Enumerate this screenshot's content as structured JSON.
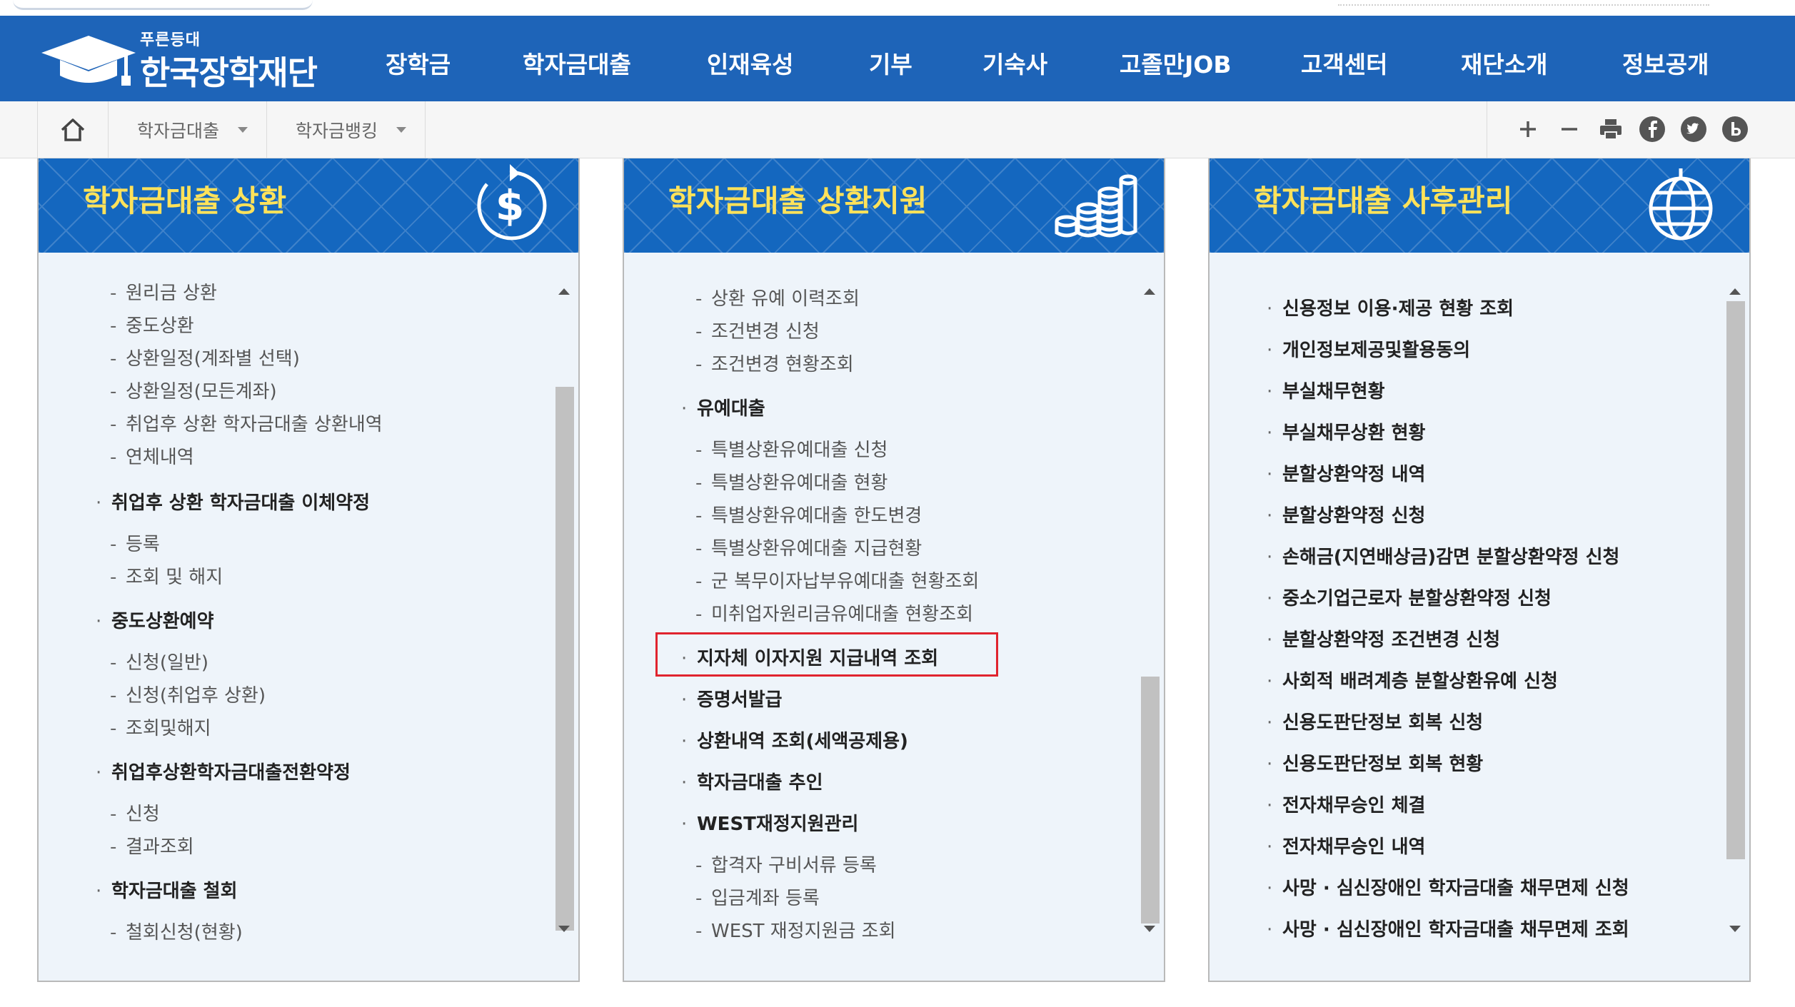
{
  "header": {
    "slogan": "푸른등대",
    "org_name": "한국장학재단",
    "nav": [
      "장학금",
      "학자금대출",
      "인재육성",
      "기부",
      "기숙사",
      "고졸만JOB",
      "고객센터",
      "재단소개",
      "정보공개"
    ]
  },
  "breadcrumb": {
    "home_icon": "home-icon",
    "items": [
      "학자금대출",
      "학자금뱅킹"
    ],
    "tools": [
      "zoom-in-icon",
      "zoom-out-icon",
      "print-icon",
      "facebook-icon",
      "twitter-icon",
      "blog-icon"
    ]
  },
  "panels": [
    {
      "title": "학자금대출 상환",
      "icon": "dollar-refresh-icon",
      "items": [
        {
          "type": "sub",
          "label": "원리금 상환"
        },
        {
          "type": "sub",
          "label": "중도상환"
        },
        {
          "type": "sub",
          "label": "상환일정(계좌별 선택)"
        },
        {
          "type": "sub",
          "label": "상환일정(모든계좌)"
        },
        {
          "type": "sub",
          "label": "취업후 상환 학자금대출 상환내역"
        },
        {
          "type": "sub",
          "label": "연체내역"
        },
        {
          "type": "main",
          "label": "취업후 상환 학자금대출 이체약정"
        },
        {
          "type": "sub",
          "label": "등록"
        },
        {
          "type": "sub",
          "label": "조회 및 해지"
        },
        {
          "type": "main",
          "label": "중도상환예약"
        },
        {
          "type": "sub",
          "label": "신청(일반)"
        },
        {
          "type": "sub",
          "label": "신청(취업후 상환)"
        },
        {
          "type": "sub",
          "label": "조회및해지"
        },
        {
          "type": "main",
          "label": "취업후상환학자금대출전환약정"
        },
        {
          "type": "sub",
          "label": "신청"
        },
        {
          "type": "sub",
          "label": "결과조회"
        },
        {
          "type": "main",
          "label": "학자금대출 철회"
        },
        {
          "type": "sub",
          "label": "철회신청(현황)"
        }
      ]
    },
    {
      "title": "학자금대출 상환지원",
      "icon": "coins-icon",
      "items": [
        {
          "type": "sub",
          "label": "상환 유예 이력조회"
        },
        {
          "type": "sub",
          "label": "조건변경 신청"
        },
        {
          "type": "sub",
          "label": "조건변경 현황조회"
        },
        {
          "type": "main",
          "label": "유예대출"
        },
        {
          "type": "sub",
          "label": "특별상환유예대출 신청"
        },
        {
          "type": "sub",
          "label": "특별상환유예대출 현황"
        },
        {
          "type": "sub",
          "label": "특별상환유예대출 한도변경"
        },
        {
          "type": "sub",
          "label": "특별상환유예대출 지급현황"
        },
        {
          "type": "sub",
          "label": "군 복무이자납부유예대출 현황조회"
        },
        {
          "type": "sub",
          "label": "미취업자원리금유예대출 현황조회"
        },
        {
          "type": "main",
          "label": "지자체 이자지원 지급내역 조회"
        },
        {
          "type": "main",
          "label": "증명서발급"
        },
        {
          "type": "main",
          "label": "상환내역 조회(세액공제용)"
        },
        {
          "type": "main",
          "label": "학자금대출 추인"
        },
        {
          "type": "main",
          "label": "WEST재정지원관리"
        },
        {
          "type": "sub",
          "label": "합격자 구비서류 등록"
        },
        {
          "type": "sub",
          "label": "입금계좌 등록"
        },
        {
          "type": "sub",
          "label": "WEST 재정지원금 조회"
        }
      ]
    },
    {
      "title": "학자금대출 사후관리",
      "icon": "globe-icon",
      "items": [
        {
          "type": "main",
          "label": "신용정보 이용·제공 현황 조회"
        },
        {
          "type": "main",
          "label": "개인정보제공및활용동의"
        },
        {
          "type": "main",
          "label": "부실채무현황"
        },
        {
          "type": "main",
          "label": "부실채무상환 현황"
        },
        {
          "type": "main",
          "label": "분할상환약정 내역"
        },
        {
          "type": "main",
          "label": "분할상환약정 신청"
        },
        {
          "type": "main",
          "label": "손해금(지연배상금)감면 분할상환약정 신청"
        },
        {
          "type": "main",
          "label": "중소기업근로자 분할상환약정 신청"
        },
        {
          "type": "main",
          "label": "분할상환약정 조건변경 신청"
        },
        {
          "type": "main",
          "label": "사회적 배려계층 분할상환유예 신청"
        },
        {
          "type": "main",
          "label": "신용도판단정보 회복 신청"
        },
        {
          "type": "main",
          "label": "신용도판단정보 회복 현황"
        },
        {
          "type": "main",
          "label": "전자채무승인 체결"
        },
        {
          "type": "main",
          "label": "전자채무승인 내역"
        },
        {
          "type": "main",
          "label": "사망 · 심신장애인 학자금대출 채무면제 신청"
        },
        {
          "type": "main",
          "label": "사망 · 심신장애인 학자금대출 채무면제 조회"
        }
      ]
    }
  ],
  "colors": {
    "header_bg": "#1e64b8",
    "panel_head_bg": "#1467bf",
    "panel_title": "#ffe25a",
    "panel_body_bg": "#eef4fa",
    "highlight": "#e0242e"
  }
}
